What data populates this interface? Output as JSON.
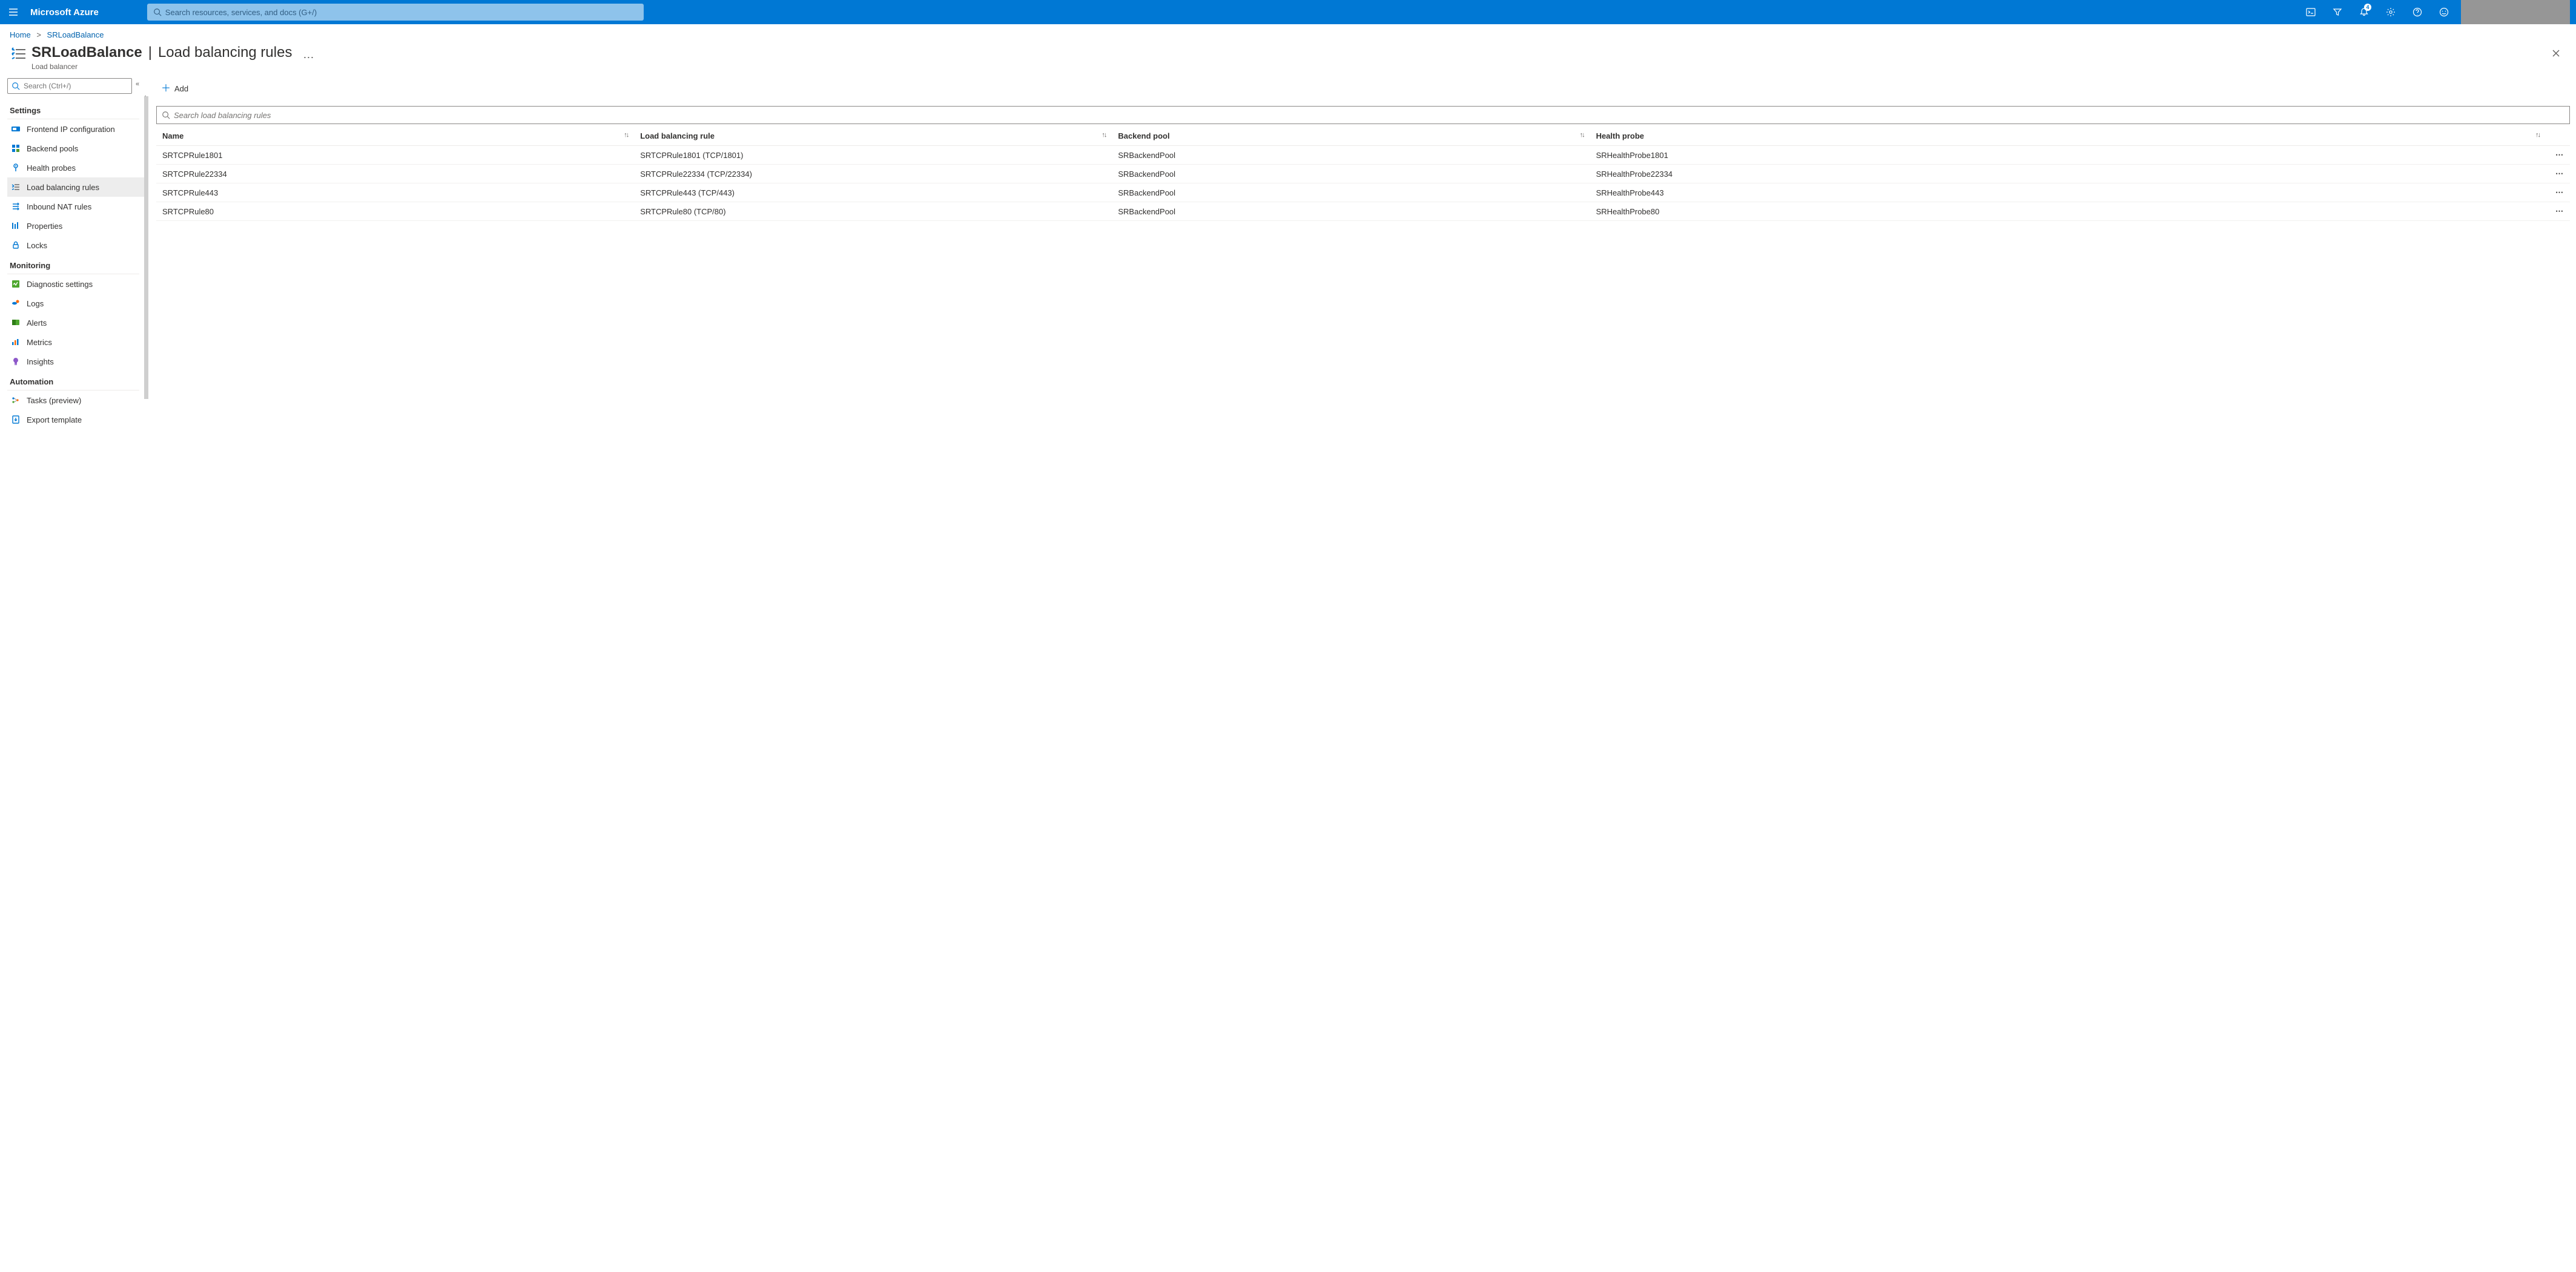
{
  "topbar": {
    "brand": "Microsoft Azure",
    "search_placeholder": "Search resources, services, and docs (G+/)",
    "notification_count": "4"
  },
  "breadcrumb": {
    "home": "Home",
    "resource": "SRLoadBalance"
  },
  "page": {
    "resource_name": "SRLoadBalance",
    "section": "Load balancing rules",
    "subtitle": "Load balancer"
  },
  "sidebar": {
    "search_placeholder": "Search (Ctrl+/)",
    "groups": [
      {
        "title": "Settings",
        "items": [
          {
            "label": "Frontend IP configuration",
            "icon": "frontend-ip-icon"
          },
          {
            "label": "Backend pools",
            "icon": "backend-pools-icon"
          },
          {
            "label": "Health probes",
            "icon": "health-probes-icon"
          },
          {
            "label": "Load balancing rules",
            "icon": "lb-rules-icon",
            "active": true
          },
          {
            "label": "Inbound NAT rules",
            "icon": "nat-rules-icon"
          },
          {
            "label": "Properties",
            "icon": "properties-icon"
          },
          {
            "label": "Locks",
            "icon": "locks-icon"
          }
        ]
      },
      {
        "title": "Monitoring",
        "items": [
          {
            "label": "Diagnostic settings",
            "icon": "diagnostic-icon"
          },
          {
            "label": "Logs",
            "icon": "logs-icon"
          },
          {
            "label": "Alerts",
            "icon": "alerts-icon"
          },
          {
            "label": "Metrics",
            "icon": "metrics-icon"
          },
          {
            "label": "Insights",
            "icon": "insights-icon"
          }
        ]
      },
      {
        "title": "Automation",
        "items": [
          {
            "label": "Tasks (preview)",
            "icon": "tasks-icon"
          },
          {
            "label": "Export template",
            "icon": "export-template-icon"
          }
        ]
      }
    ]
  },
  "commands": {
    "add": "Add"
  },
  "table": {
    "search_placeholder": "Search load balancing rules",
    "columns": [
      "Name",
      "Load balancing rule",
      "Backend pool",
      "Health probe"
    ],
    "rows": [
      {
        "name": "SRTCPRule1801",
        "rule": "SRTCPRule1801 (TCP/1801)",
        "pool": "SRBackendPool",
        "probe": "SRHealthProbe1801"
      },
      {
        "name": "SRTCPRule22334",
        "rule": "SRTCPRule22334 (TCP/22334)",
        "pool": "SRBackendPool",
        "probe": "SRHealthProbe22334"
      },
      {
        "name": "SRTCPRule443",
        "rule": "SRTCPRule443 (TCP/443)",
        "pool": "SRBackendPool",
        "probe": "SRHealthProbe443"
      },
      {
        "name": "SRTCPRule80",
        "rule": "SRTCPRule80 (TCP/80)",
        "pool": "SRBackendPool",
        "probe": "SRHealthProbe80"
      }
    ]
  }
}
